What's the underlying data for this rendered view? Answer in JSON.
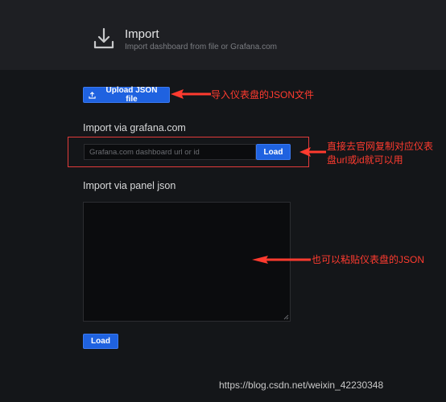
{
  "header": {
    "title": "Import",
    "subtitle": "Import dashboard from file or Grafana.com",
    "icon": "download-icon"
  },
  "upload": {
    "button_label": "Upload JSON file",
    "icon": "upload-icon"
  },
  "grafana_com": {
    "section_label": "Import via grafana.com",
    "input_placeholder": "Grafana.com dashboard url or id",
    "input_value": "",
    "load_label": "Load"
  },
  "panel_json": {
    "section_label": "Import via panel json",
    "textarea_value": "",
    "load_label": "Load"
  },
  "annotations": {
    "upload_note": "导入仪表盘的JSON文件",
    "url_note_line1": "直接去官网复制对应仪表",
    "url_note_line2": "盘url或id就可以用",
    "json_note": "也可以粘贴仪表盘的JSON",
    "color": "#ff3b2f"
  },
  "watermark": "https://blog.csdn.net/weixin_42230348",
  "colors": {
    "background": "#141619",
    "header_bg": "#1e1f23",
    "primary_button": "#1f62e0"
  }
}
